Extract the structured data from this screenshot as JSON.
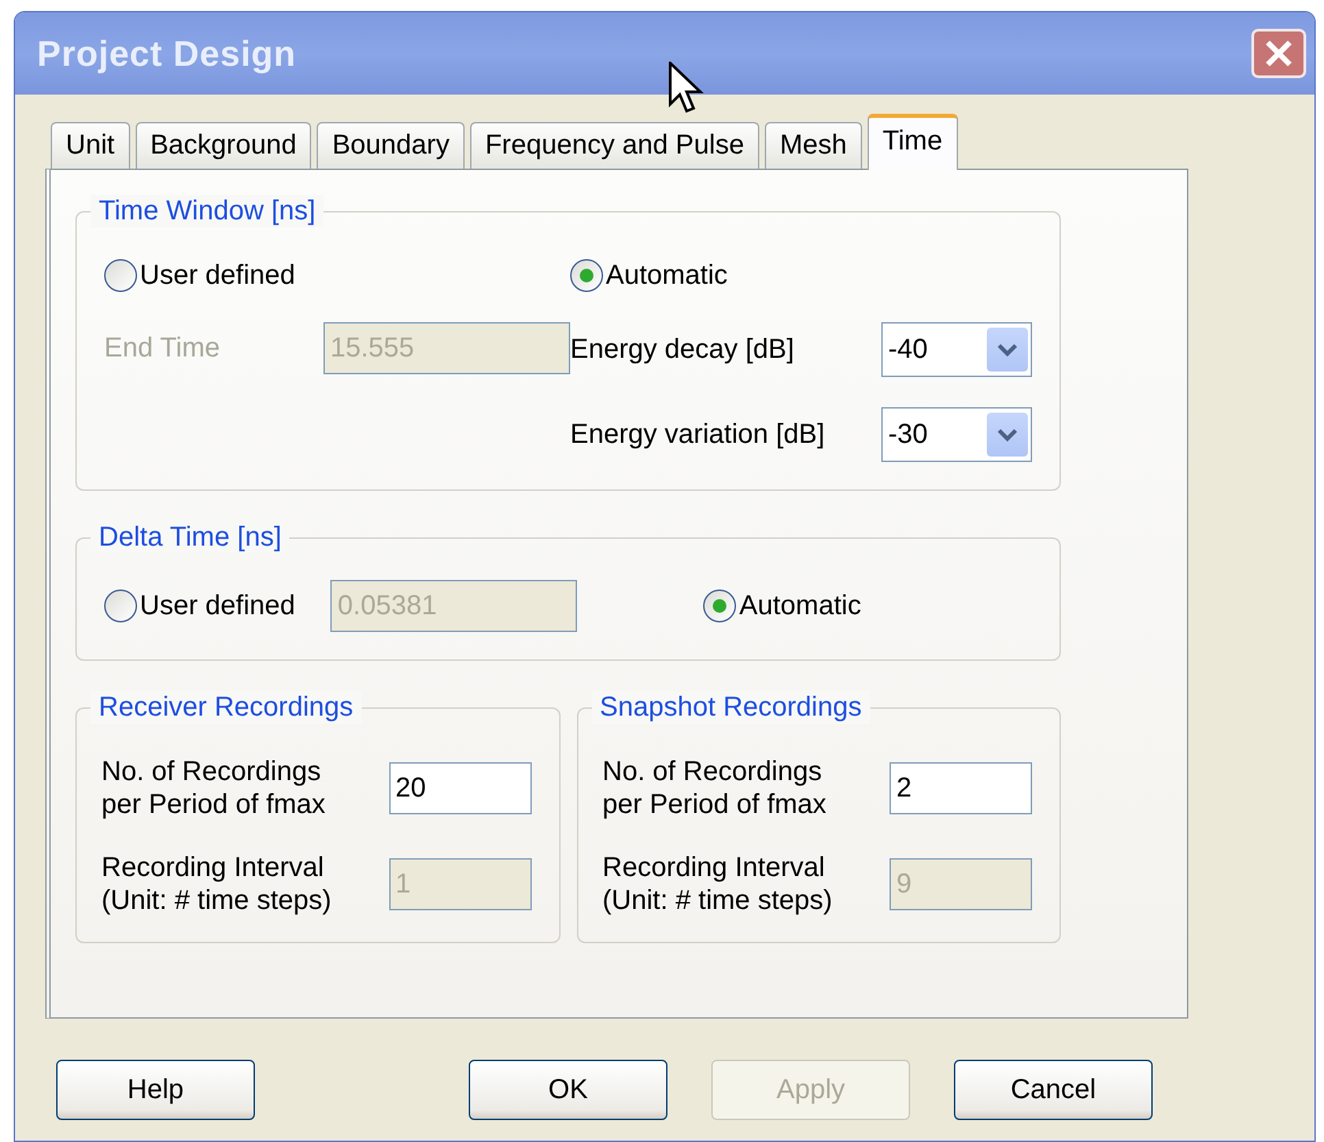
{
  "window": {
    "title": "Project Design"
  },
  "tabs": [
    {
      "label": "Unit",
      "selected": false
    },
    {
      "label": "Background",
      "selected": false
    },
    {
      "label": "Boundary",
      "selected": false
    },
    {
      "label": "Frequency and Pulse",
      "selected": false
    },
    {
      "label": "Mesh",
      "selected": false
    },
    {
      "label": "Time",
      "selected": true
    }
  ],
  "time_window": {
    "title": "Time Window [ns]",
    "options": [
      {
        "label": "User defined",
        "selected": false
      },
      {
        "label": "Automatic",
        "selected": true
      }
    ],
    "end_time": {
      "label": "End Time",
      "value": "15.555",
      "disabled": true
    },
    "dropdowns": [
      {
        "label": "Energy decay [dB]",
        "value": "-40"
      },
      {
        "label": "Energy variation [dB]",
        "value": "-30"
      }
    ]
  },
  "delta_time": {
    "title": "Delta Time [ns]",
    "options": [
      {
        "label": "User defined",
        "selected": false
      },
      {
        "label": "Automatic",
        "selected": true
      }
    ],
    "field": {
      "value": "0.05381",
      "disabled": true
    }
  },
  "recordings": [
    {
      "title": "Receiver Recordings",
      "rows": [
        {
          "label": "No. of Recordings\nper Period of fmax",
          "value": "20",
          "disabled": false
        },
        {
          "label": "Recording Interval\n(Unit: # time steps)",
          "value": "1",
          "disabled": true
        }
      ]
    },
    {
      "title": "Snapshot Recordings",
      "rows": [
        {
          "label": "No. of Recordings\nper Period of fmax",
          "value": "2",
          "disabled": false
        },
        {
          "label": "Recording Interval\n(Unit: # time steps)",
          "value": "9",
          "disabled": true
        }
      ]
    }
  ],
  "buttons": [
    {
      "label": "Help",
      "disabled": false
    },
    {
      "label": "OK",
      "disabled": false
    },
    {
      "label": "Apply",
      "disabled": true
    },
    {
      "label": "Cancel",
      "disabled": false
    }
  ]
}
